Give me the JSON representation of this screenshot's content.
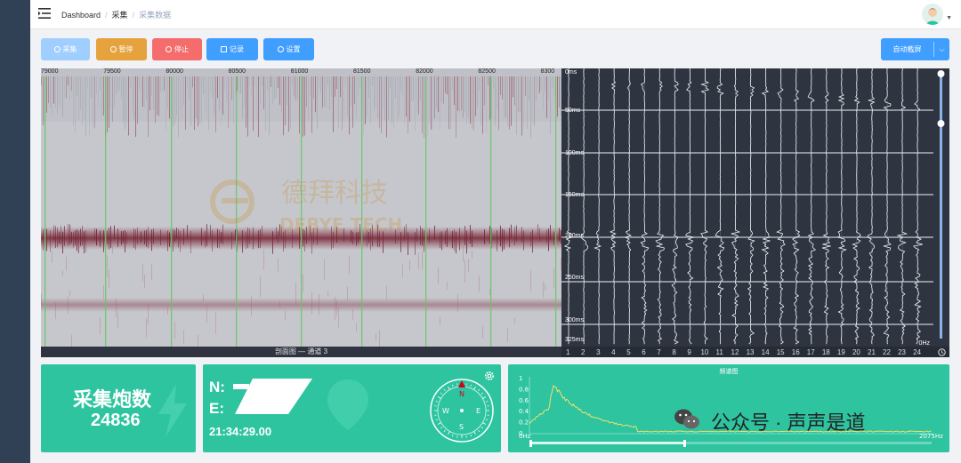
{
  "breadcrumb": {
    "home": "Dashboard",
    "section": "采集",
    "current": "采集数据"
  },
  "toolbar": {
    "start_label": "采集",
    "pause_label": "暂停",
    "stop_label": "停止",
    "record_label": "记录",
    "settings_label": "设置",
    "auto_capture_label": "自动截屏"
  },
  "profile": {
    "ticks": [
      "79000",
      "79500",
      "80000",
      "80500",
      "81000",
      "81500",
      "82000",
      "82500",
      "8300"
    ],
    "caption": "剖面图 — 通道 3"
  },
  "waveform": {
    "time_labels": [
      "0ms",
      "50ms",
      "100ms",
      "150ms",
      "200ms",
      "250ms",
      "300ms",
      "325ms"
    ],
    "channels": [
      "1",
      "2",
      "3",
      "4",
      "5",
      "6",
      "7",
      "8",
      "9",
      "10",
      "11",
      "12",
      "13",
      "14",
      "15",
      "16",
      "17",
      "18",
      "19",
      "20",
      "21",
      "22",
      "23",
      "24"
    ],
    "corner_label": "0Hz"
  },
  "stats": {
    "shots_title": "采集炮数",
    "shots_value": "24836",
    "n_label": "N:",
    "e_label": "E:",
    "time": "21:34:29.00",
    "compass": {
      "n": "N",
      "e": "E",
      "s": "S",
      "w": "W"
    }
  },
  "spectrum": {
    "title": "频谱图",
    "y_ticks": [
      "1",
      "0.8",
      "0.6",
      "0.4",
      "0.2",
      "0"
    ],
    "x_min_label": "0Hz",
    "x_max_label": "2075Hz"
  },
  "watermark": {
    "brand": "德拜科技",
    "brand_en": "DEBYE TECH",
    "wechat": "公众号 · 声声是道"
  },
  "colors": {
    "primary": "#409eff",
    "warning": "#e6a23c",
    "danger": "#f56c6c",
    "disabled": "#a0cfff",
    "card": "#2ec4a0",
    "wave_bg": "#2e3440"
  }
}
